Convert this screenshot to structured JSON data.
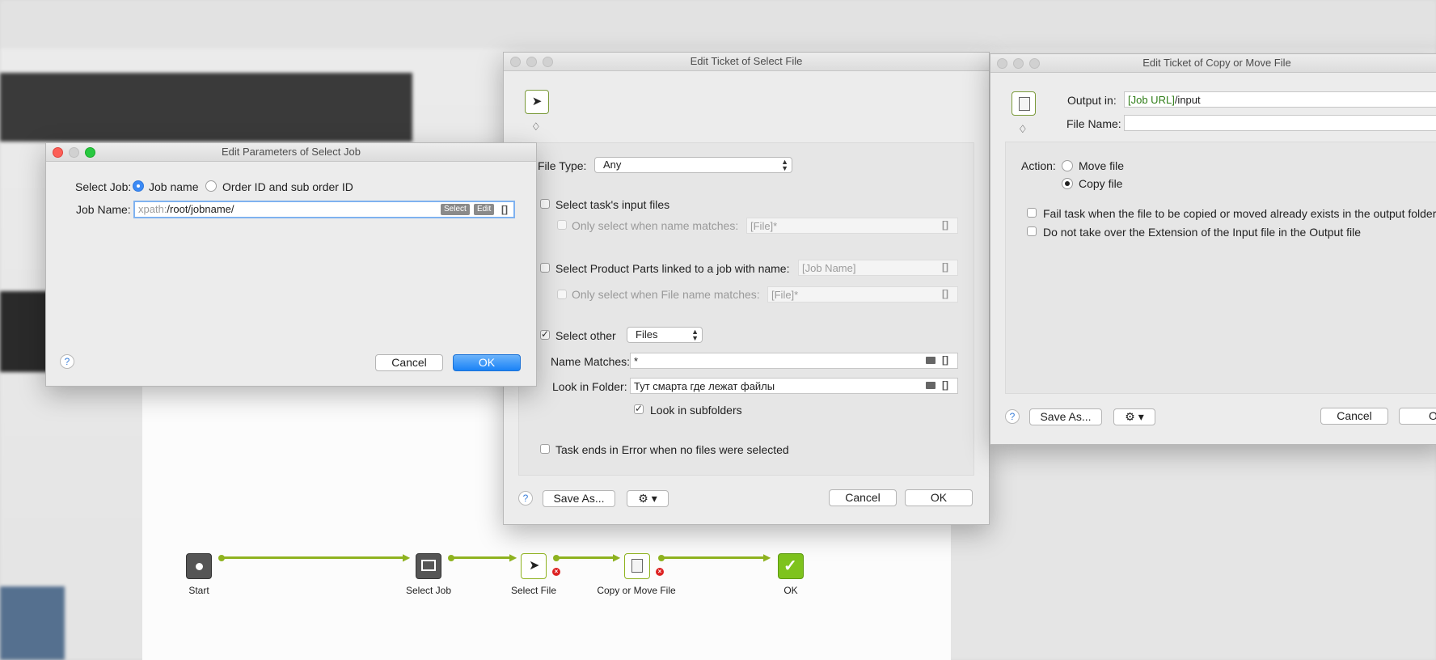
{
  "select_job_dialog": {
    "title": "Edit Parameters of Select Job",
    "select_job_label": "Select Job:",
    "option_job_name": "Job name",
    "option_order_id": "Order ID and sub order ID",
    "job_name_label": "Job Name:",
    "job_name_prefix": "xpath:",
    "job_name_value": "/root/jobname/",
    "select_tag": "Select",
    "edit_tag": "Edit",
    "brackets": "[]",
    "help": "?",
    "cancel": "Cancel",
    "ok": "OK"
  },
  "select_file_dialog": {
    "title": "Edit Ticket of Select File",
    "file_type_label": "File Type:",
    "file_type_value": "Any",
    "tasks_input_label": "Select task's input files",
    "only_name_matches_label": "Only select when name matches:",
    "only_name_matches_value": "[File]*",
    "product_parts_label": "Select Product Parts linked to a job with name:",
    "product_parts_value": "[Job Name]",
    "only_file_name_label": "Only select when File name matches:",
    "only_file_name_value": "[File]*",
    "select_other_label": "Select other",
    "select_other_value": "Files",
    "name_matches_label": "Name Matches:",
    "name_matches_value": "*",
    "look_in_folder_label": "Look in Folder:",
    "look_in_folder_value": "Тут смарта где лежат файлы",
    "look_in_subfolders_label": "Look in subfolders",
    "task_ends_label": "Task ends in Error when no files were selected",
    "brackets": "[]",
    "help": "?",
    "save_as": "Save As...",
    "cancel": "Cancel",
    "ok": "OK"
  },
  "copy_move_dialog": {
    "title": "Edit Ticket of Copy or Move File",
    "output_in_label": "Output in:",
    "output_in_var": "[Job URL]",
    "output_in_rest": "/input",
    "file_name_label": "File Name:",
    "action_label": "Action:",
    "move_file": "Move file",
    "copy_file": "Copy file",
    "fail_task_label": "Fail task when the file to be copied or moved already exists in the output folder",
    "extension_label": "Do not take over the Extension of the Input file in the Output file",
    "help": "?",
    "save_as": "Save As...",
    "cancel": "Cancel",
    "ok_partial": "O"
  },
  "flow": {
    "start": "Start",
    "select_job": "Select Job",
    "select_file": "Select File",
    "copy_move": "Copy or Move File",
    "ok": "OK"
  },
  "colors": {
    "accent_blue": "#1a82f6",
    "flow_green": "#8fb320",
    "var_green": "#2e7d16"
  }
}
